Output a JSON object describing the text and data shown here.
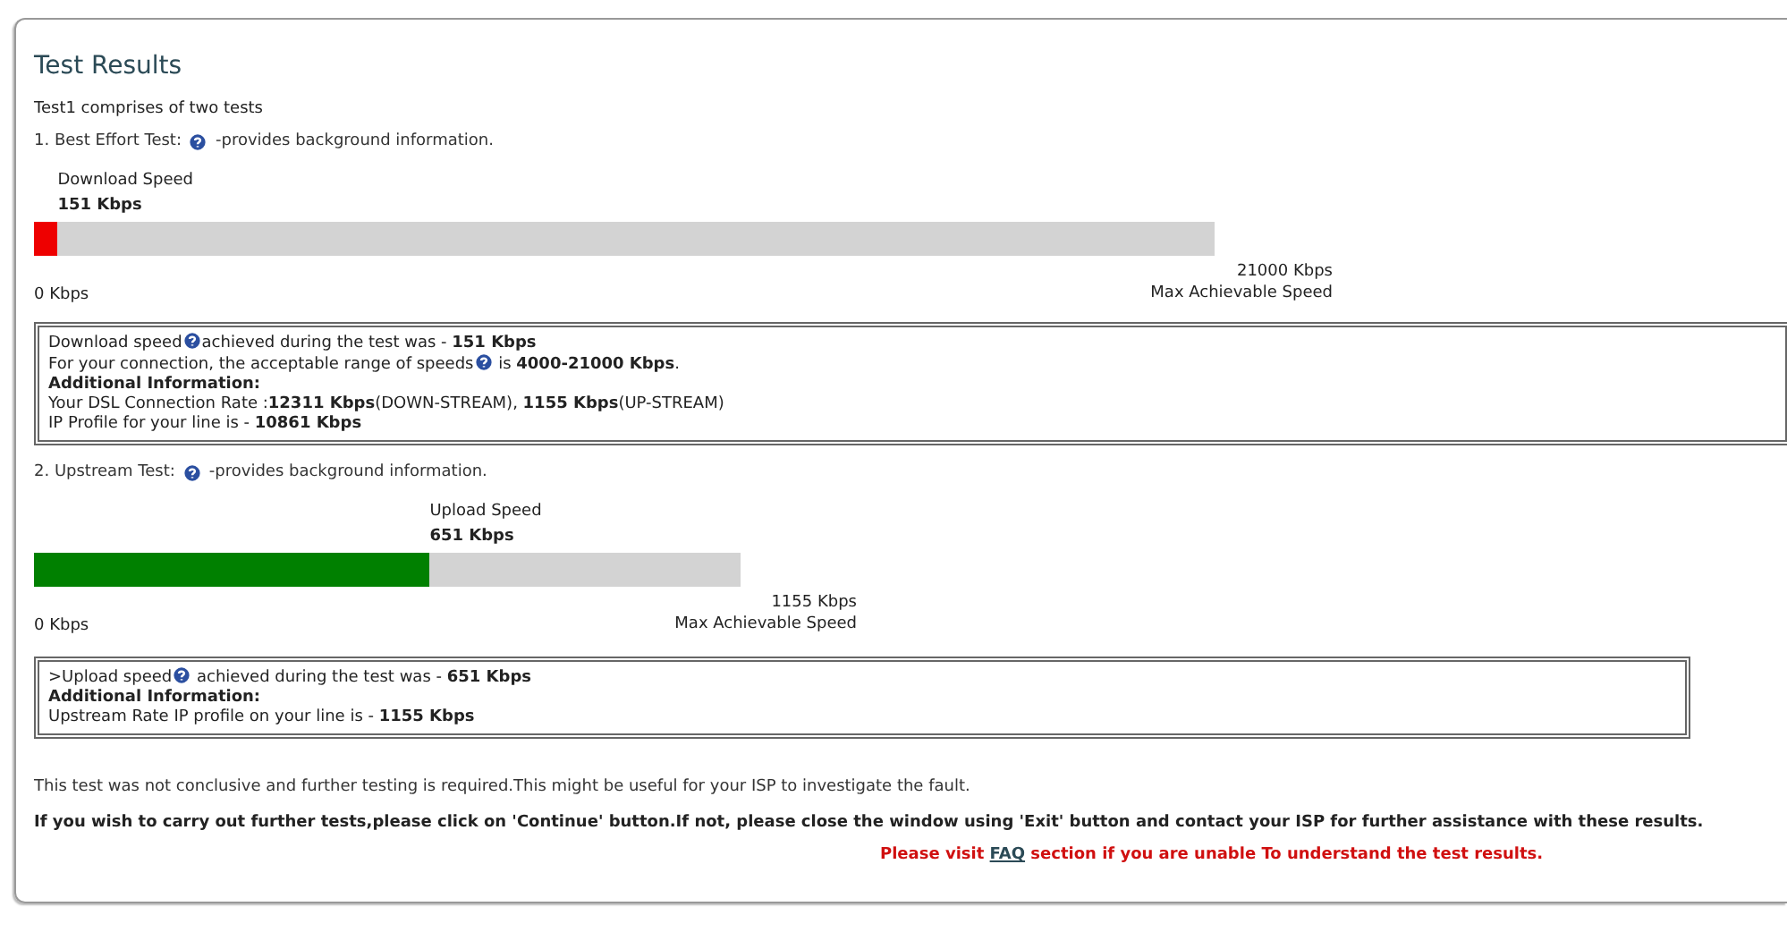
{
  "title": "Test Results",
  "intro": "Test1 comprises of two tests",
  "tests": [
    {
      "heading": "1. Best Effort Test:",
      "heading_after": "-provides background information.",
      "meter": {
        "label": "Download  Speed",
        "value": "151 Kbps",
        "level": 0.02,
        "color": "#ee0000",
        "min": "0 Kbps",
        "max": "21000 Kbps",
        "max_caption": "Max Achievable Speed"
      },
      "info": [
        [
          {
            "kind": "text",
            "text": "Download speed"
          },
          {
            "kind": "help"
          },
          {
            "kind": "text",
            "text": "achieved during the test was - **151 Kbps**"
          }
        ],
        [
          {
            "kind": "text",
            "text": "For your connection, the acceptable range of speeds"
          },
          {
            "kind": "help"
          },
          {
            "kind": "text",
            "text": " is **4000-21000 Kbps**."
          }
        ],
        [
          {
            "kind": "text",
            "text": "**Additional Information:**"
          }
        ],
        [
          {
            "kind": "text",
            "text": "Your DSL Connection Rate :**12311 Kbps**(DOWN-STREAM), **1155 Kbps**(UP-STREAM)"
          }
        ],
        [
          {
            "kind": "text",
            "text": "IP Profile for your line is - **10861 Kbps**"
          }
        ]
      ]
    },
    {
      "heading": "2. Upstream Test:",
      "heading_after": "-provides background information.",
      "meter": {
        "label": "Upload Speed",
        "value": "651 Kbps",
        "level": 0.56,
        "color": "#008000",
        "min": "0 Kbps",
        "max": "1155 Kbps",
        "max_caption": "Max Achievable Speed"
      },
      "info": [
        [
          {
            "kind": "text",
            "text": ">Upload speed"
          },
          {
            "kind": "help"
          },
          {
            "kind": "text",
            "text": " achieved during the test was - **651 Kbps**"
          }
        ],
        [
          {
            "kind": "text",
            "text": "**Additional Information:**"
          }
        ],
        [
          {
            "kind": "text",
            "text": "Upstream Rate IP profile on your line is - **1155 Kbps**"
          }
        ]
      ]
    }
  ],
  "note": "This test was not conclusive and further testing is required.This might be useful for your ISP to investigate the fault.",
  "instruction": "If you wish to carry out further tests,please click on 'Continue' button.If not, please close the window using 'Exit' button and contact your ISP for further assistance with these results.",
  "faq": {
    "before": "Please visit ",
    "link": "FAQ",
    "after": " section if you are unable To understand the test results."
  }
}
